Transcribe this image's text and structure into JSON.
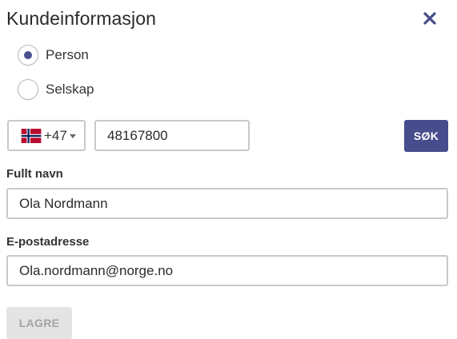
{
  "dialog": {
    "title": "Kundeinformasjon",
    "close_icon": "close-icon"
  },
  "customer_type": {
    "options": [
      {
        "label": "Person",
        "selected": true
      },
      {
        "label": "Selskap",
        "selected": false
      }
    ]
  },
  "phone": {
    "country_flag": "norway-flag-icon",
    "dial_code": "+47",
    "number": "48167800"
  },
  "search": {
    "label": "SØK"
  },
  "full_name": {
    "label": "Fullt navn",
    "value": "Ola Nordmann"
  },
  "email": {
    "label": "E-postadresse",
    "value": "Ola.nordmann@norge.no"
  },
  "save": {
    "label": "LAGRE",
    "disabled": true
  },
  "colors": {
    "accent": "#474c8c",
    "border": "#c9c9c9",
    "disabled_bg": "#e4e4e4",
    "disabled_text": "#a3a3a3"
  }
}
